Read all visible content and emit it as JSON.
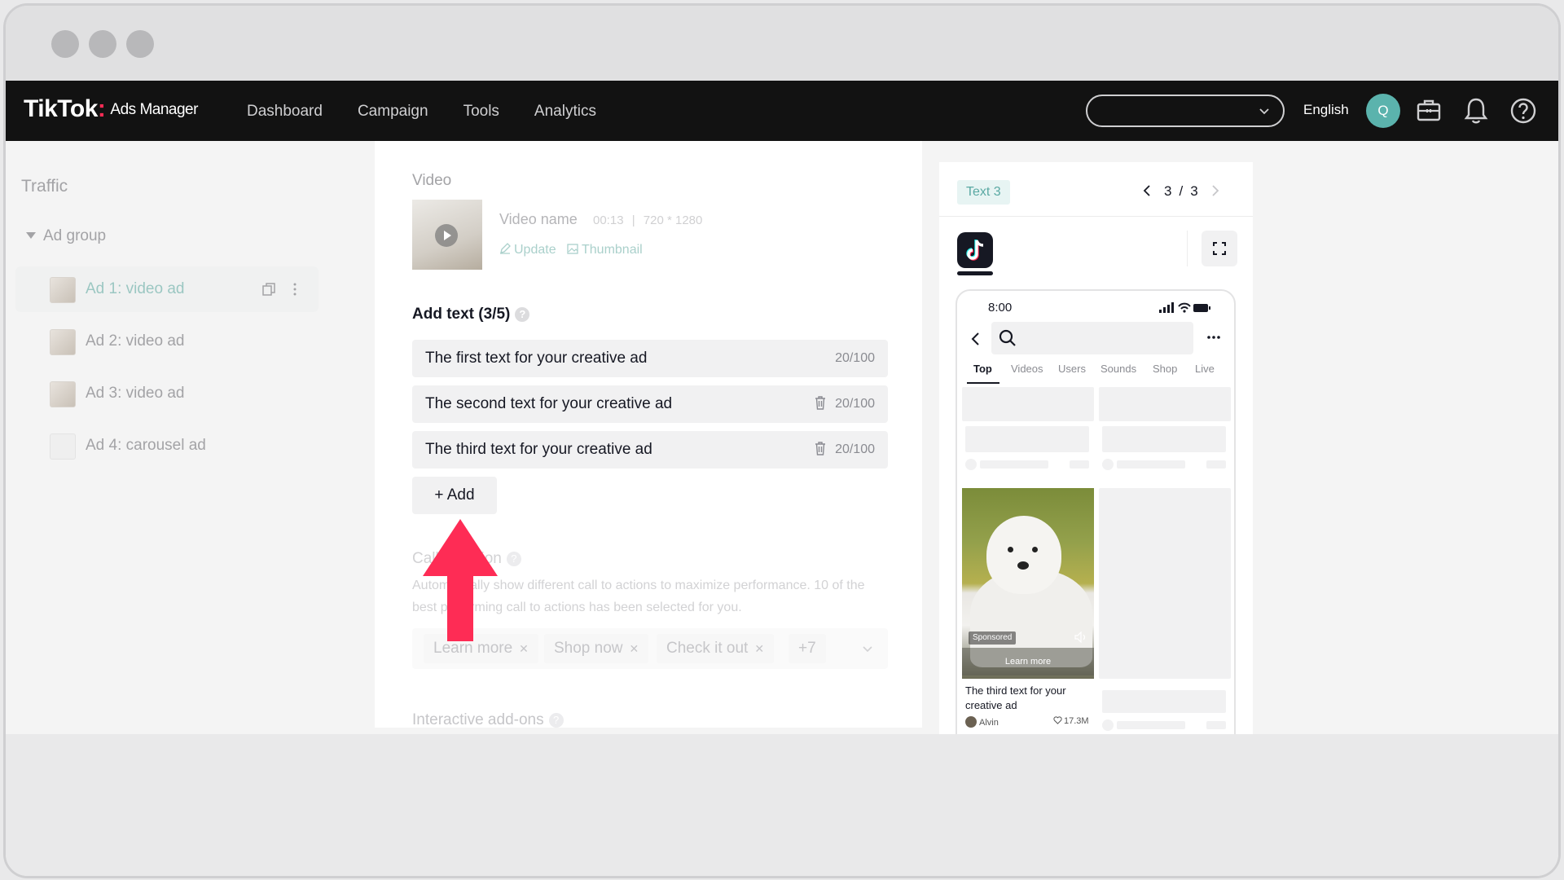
{
  "header": {
    "logo_main": "TikTok",
    "logo_colon": ":",
    "logo_sub": "Ads Manager",
    "nav": [
      "Dashboard",
      "Campaign",
      "Tools",
      "Analytics"
    ],
    "account_select_value": "",
    "language": "English",
    "avatar_initial": "Q"
  },
  "sidebar": {
    "title": "Traffic",
    "group": "Ad group",
    "items": [
      {
        "label": "Ad 1: video ad",
        "active": true
      },
      {
        "label": "Ad 2: video ad",
        "active": false
      },
      {
        "label": "Ad 3: video ad",
        "active": false
      },
      {
        "label": "Ad 4: carousel ad",
        "active": false
      }
    ]
  },
  "main": {
    "video_section_label": "Video",
    "video_name": "Video name",
    "video_duration": "00:13",
    "video_resolution": "720 * 1280",
    "update_label": "Update",
    "thumbnail_label": "Thumbnail",
    "add_text_title": "Add text (3/5)",
    "texts": [
      {
        "value": "The first text for your creative ad",
        "count": "20/100",
        "deletable": false
      },
      {
        "value": "The second text for your creative ad",
        "count": "20/100",
        "deletable": true
      },
      {
        "value": "The third text for your creative ad",
        "count": "20/100",
        "deletable": true
      }
    ],
    "add_button_label": "+ Add",
    "cta_title": "Call to action",
    "cta_description": "Automatically show different call to actions to maximize performance. 10 of the best performing call to actions has been selected for you.",
    "cta_chips": [
      "Learn more",
      "Shop now",
      "Check it out"
    ],
    "cta_more": "+7",
    "interactive_title": "Interactive add-ons"
  },
  "preview": {
    "tag": "Text 3",
    "page_current": "3",
    "page_sep": "/",
    "page_total": "3",
    "phone_time": "8:00",
    "tabs": [
      "Top",
      "Videos",
      "Users",
      "Sounds",
      "Shop",
      "Live"
    ],
    "sponsored": "Sponsored",
    "learn_more": "Learn more",
    "caption": "The third text for your creative ad",
    "author": "Alvin",
    "likes": "17.3M"
  },
  "colors": {
    "topbar": "#121212",
    "accent_teal": "#5bb3ad",
    "arrow": "#fe2c55"
  }
}
